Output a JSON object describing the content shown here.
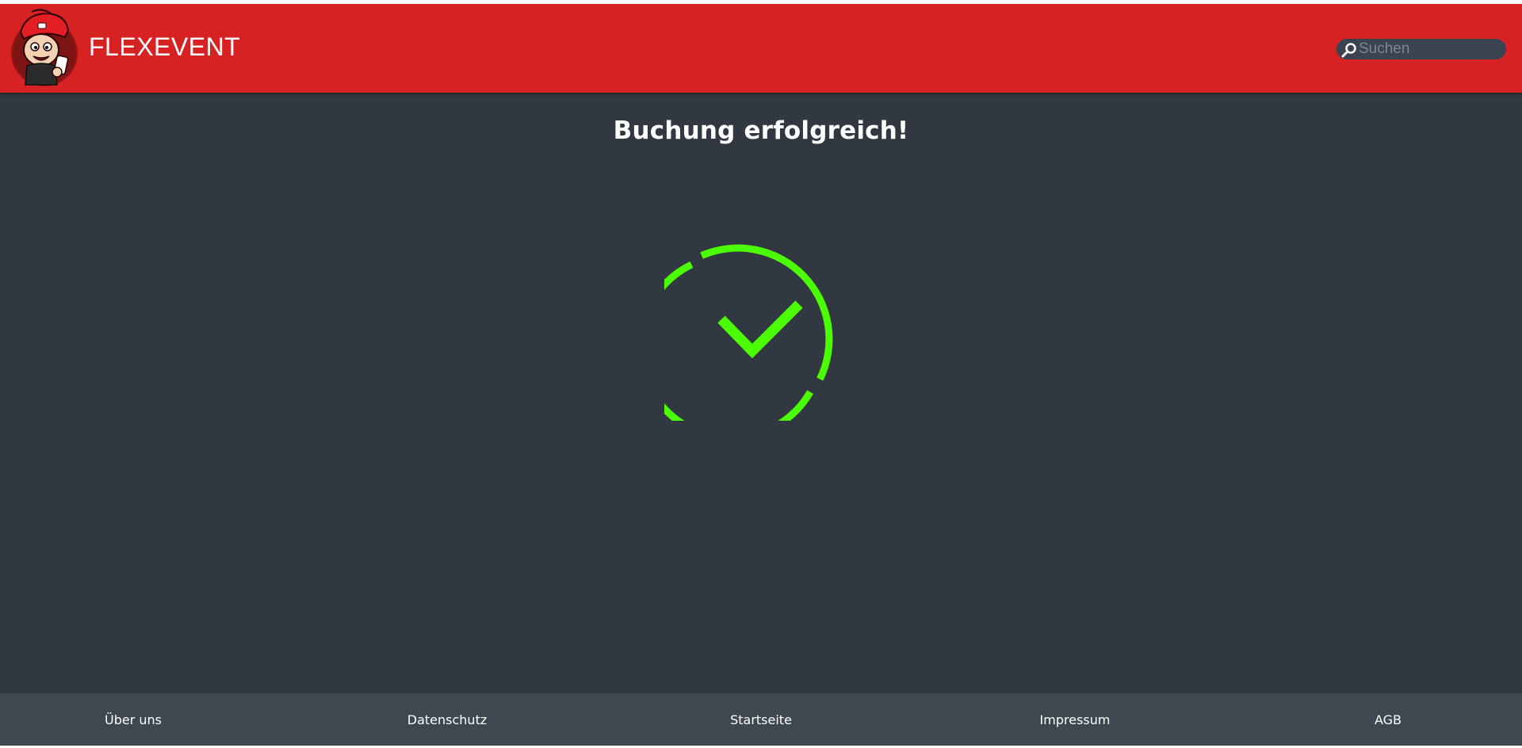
{
  "header": {
    "brand": "FLEXEVENT",
    "accent_color": "#d62222",
    "logo_icon": "mascot-logo-icon"
  },
  "search": {
    "placeholder": "Suchen",
    "value": "",
    "icon": "search-icon"
  },
  "main": {
    "title": "Buchung erfolgreich!",
    "status_icon": "success-check-icon",
    "success_color": "#4cff00"
  },
  "footer": {
    "links": [
      "Über uns",
      "Datenschutz",
      "Startseite",
      "Impressum",
      "AGB"
    ]
  }
}
